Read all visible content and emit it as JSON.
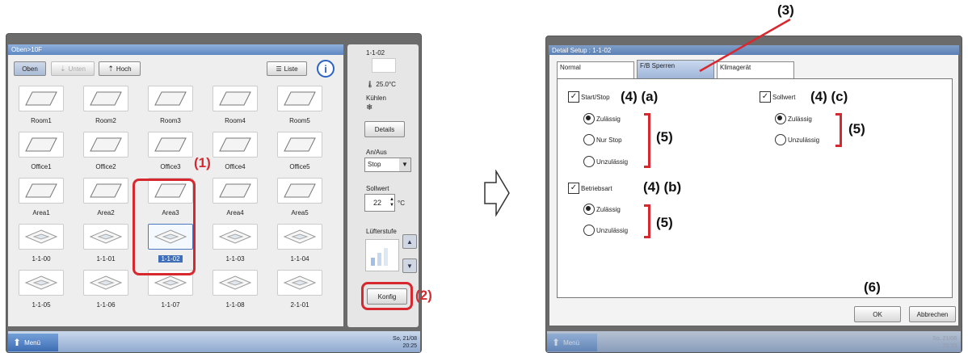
{
  "left": {
    "breadcrumb": "Oben>10F",
    "nav": {
      "oben": "Oben",
      "unten": "Unten",
      "hoch": "Hoch",
      "liste": "Liste",
      "info_icon": "info-icon"
    },
    "rows": [
      [
        "Room1",
        "Room2",
        "Room3",
        "Room4",
        "Room5"
      ],
      [
        "Office1",
        "Office2",
        "Office3",
        "Office4",
        "Office5"
      ],
      [
        "Area1",
        "Area2",
        "Area3",
        "Area4",
        "Area5"
      ],
      [
        "1-1-00",
        "1-1-01",
        "1-1-02",
        "1-1-03",
        "1-1-04"
      ],
      [
        "1-1-05",
        "1-1-06",
        "1-1-07",
        "1-1-08",
        "2-1-01"
      ]
    ],
    "selected": "1-1-02",
    "panel": {
      "unit": "1-1-02",
      "temperature": "25.0°C",
      "mode": "Kühlen",
      "details_button": "Details",
      "an_aus_label": "An/Aus",
      "an_aus_value": "Stop",
      "sollwert_label": "Sollwert",
      "sollwert_value": "22",
      "sollwert_unit": "°C",
      "lufter_label": "Lüfterstufe",
      "konfig_button": "Konfig"
    },
    "menu": "Menü",
    "clock_date": "So, 21/08",
    "clock_time": "20:25"
  },
  "right": {
    "title": "Detail Setup : 1-1-02",
    "tabs": [
      "Normal",
      "F/B Sperren",
      "Klimagerät"
    ],
    "start_stop": {
      "label": "Start/Stop",
      "options": [
        "Zulässig",
        "Nur Stop",
        "Unzulässig"
      ],
      "selected": "Zulässig"
    },
    "betriebsart": {
      "label": "Betriebsart",
      "options": [
        "Zulässig",
        "Unzulässig"
      ],
      "selected": "Zulässig"
    },
    "sollwert": {
      "label": "Sollwert",
      "options": [
        "Zulässig",
        "Unzulässig"
      ],
      "selected": "Zulässig"
    },
    "ok": "OK",
    "cancel": "Abbrechen",
    "menu": "Menü",
    "clock_date": "So, 21/08",
    "clock_time": "20:33"
  },
  "callouts": {
    "c1": "(1)",
    "c2": "(2)",
    "c3": "(3)",
    "c4a": "(4) (a)",
    "c4b": "(4) (b)",
    "c4c": "(4) (c)",
    "c5": "(5)",
    "c6": "(6)"
  },
  "arrow_icon": "right-arrow-icon"
}
